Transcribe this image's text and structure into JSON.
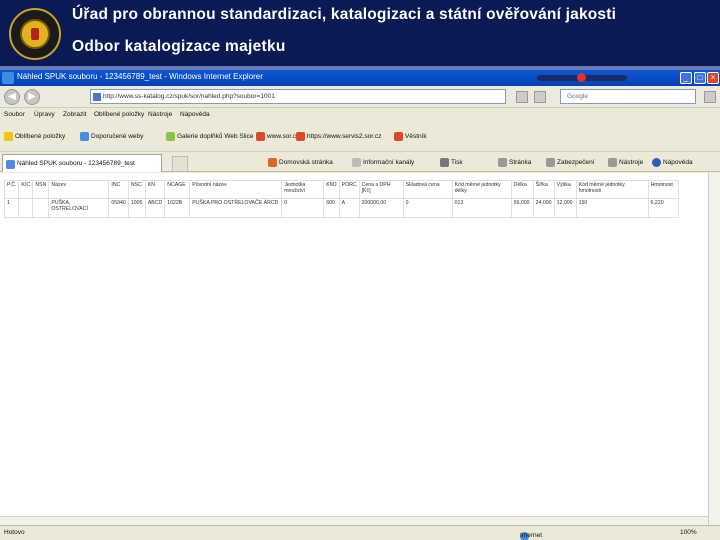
{
  "slide": {
    "title_line1": "Úřad pro obrannou standardizaci, katalogizaci a státní ověřování jakosti",
    "title_line2": "Odbor katalogizace majetku"
  },
  "browser": {
    "window_title": "Náhled SPUK souboru - 123456789_test - Windows Internet Explorer",
    "address": "http://www.ss-katalog.cz/spuk/sor/nahled.php?soubor=1001",
    "search_placeholder": "Google",
    "minimize": "_",
    "maximize": "□",
    "close": "×",
    "back_glyph": "◀",
    "forward_glyph": "▶",
    "menu": [
      "Soubor",
      "Úpravy",
      "Zobrazit",
      "Oblíbené položky",
      "Nástroje",
      "Nápověda"
    ],
    "links": [
      "Oblíbené položky",
      "Doporučené weby",
      "Galerie doplňků Web Slice",
      "www.sor.cz",
      "https://www.servis2.sor.cz",
      "Věstník"
    ],
    "tab_label": "Náhled SPUK souboru - 123456789_test",
    "commands": [
      "Domovská stránka",
      "Informační kanály",
      "Tisk",
      "Stránka",
      "Zabezpečení",
      "Nástroje",
      "Nápověda"
    ],
    "status_left": "Hotovo",
    "status_zone": "Internet",
    "zoom": "100%"
  },
  "table": {
    "headers": [
      "P.Č.",
      "KIC",
      "NSN",
      "Název",
      "INC",
      "NSC",
      "KN",
      "NCAGE",
      "Původní název",
      "Jednotka množství",
      "KMJ",
      "PORC",
      "Cena s DPH [Kč]",
      "Skladová cena",
      "Kód měrné jednotky délky",
      "Délka",
      "Šířka",
      "Výška",
      "Kód měrné jednotky hmotnosti",
      "Hmotnost"
    ],
    "rows": [
      [
        "1",
        "",
        "",
        "PUŠKA, OSTŘELOVACÍ",
        "05940",
        "1005",
        "ABCD",
        "1022B",
        "PUŠKA PRO OSTŘELOVAČE ÁRCD",
        "0",
        "600",
        "A",
        "200000,00",
        "0",
        "013",
        "59,000",
        "24,000",
        "12,000",
        "150",
        "6,220"
      ]
    ]
  }
}
